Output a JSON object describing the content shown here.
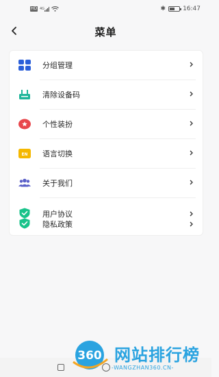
{
  "status_bar": {
    "hd_badge": "HD",
    "signal_label": "4G",
    "time": "16:47",
    "battery_level": 0.55,
    "bluetooth_icon": "bluetooth-icon",
    "wifi_icon": "wifi-icon"
  },
  "header": {
    "title": "菜单",
    "back_icon": "back-arrow-icon"
  },
  "menu": {
    "items": [
      {
        "label": "分组管理",
        "icon": "group-grid-icon",
        "color": "#2b5fd9"
      },
      {
        "label": "清除设备码",
        "icon": "device-clear-icon",
        "color": "#1fb59a"
      },
      {
        "label": "个性装扮",
        "icon": "theme-icon",
        "color": "#e8474c"
      },
      {
        "label": "语言切换",
        "icon": "language-en-icon",
        "color": "#f5b800",
        "icon_text": "EN"
      },
      {
        "label": "关于我们",
        "icon": "team-icon",
        "color": "#5a5fc8"
      }
    ],
    "legal": [
      {
        "label": "用户协议",
        "icon": "shield-check-icon",
        "color": "#19c38a"
      },
      {
        "label": "隐私政策",
        "icon": "shield-check-icon",
        "color": "#19c38a"
      }
    ]
  },
  "watermark": {
    "logo_number": "360",
    "name": "网站排行榜",
    "url": "-WANGZHAN360.CN-"
  }
}
